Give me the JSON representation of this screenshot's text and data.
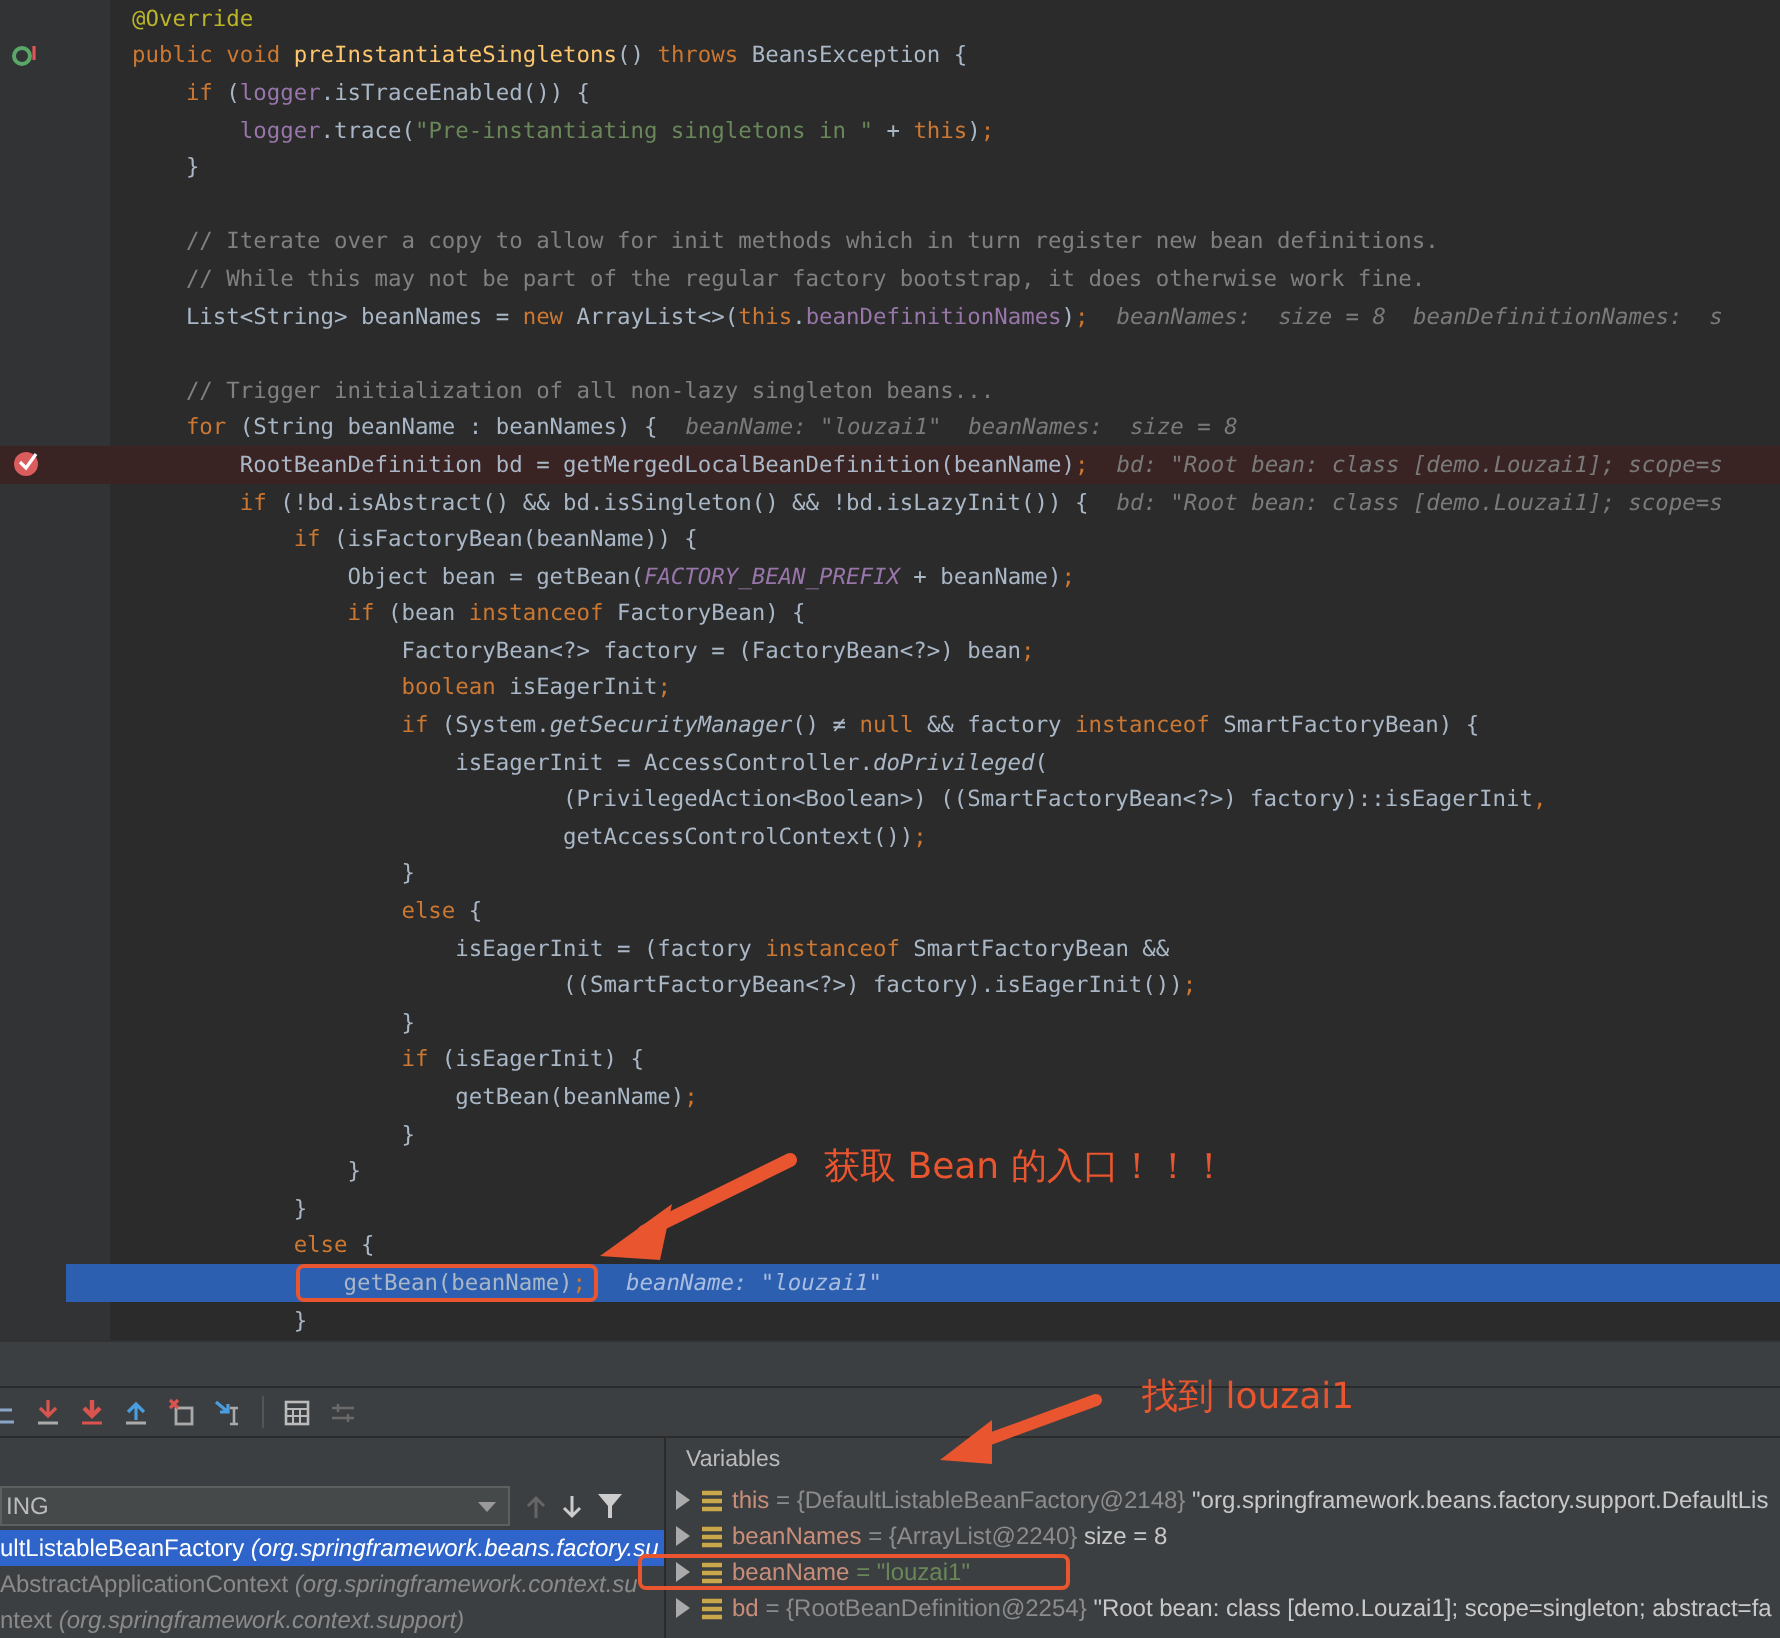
{
  "editor": {
    "lines": [
      {
        "kind": "normal",
        "boxed": false,
        "tokens": [
          {
            "text": "@Override",
            "kind": "annotation"
          }
        ]
      },
      {
        "kind": "declaration",
        "boxed": false,
        "tokens": [
          {
            "text": "public void ",
            "kind": "keyword"
          },
          {
            "text": "preInstantiateSingletons",
            "kind": "declaration"
          },
          {
            "text": "() ",
            "kind": "plain"
          },
          {
            "text": "throws ",
            "kind": "keyword"
          },
          {
            "text": "BeansException {",
            "kind": "plain"
          }
        ]
      },
      {
        "kind": "normal",
        "boxed": false,
        "tokens": [
          {
            "text": "    if ",
            "kind": "keyword"
          },
          {
            "text": "(",
            "kind": "plain"
          },
          {
            "text": "logger",
            "kind": "field"
          },
          {
            "text": ".isTraceEnabled()) {",
            "kind": "plain"
          }
        ]
      },
      {
        "kind": "normal",
        "boxed": false,
        "tokens": [
          {
            "text": "        logger",
            "kind": "field"
          },
          {
            "text": ".trace(",
            "kind": "plain"
          },
          {
            "text": "\"Pre-instantiating singletons in \"",
            "kind": "string"
          },
          {
            "text": " + ",
            "kind": "plain"
          },
          {
            "text": "this",
            "kind": "keyword"
          },
          {
            "text": ")",
            "kind": "plain"
          },
          {
            "text": ";",
            "kind": "keyword"
          }
        ]
      },
      {
        "kind": "normal",
        "boxed": false,
        "tokens": [
          {
            "text": "    }",
            "kind": "plain"
          }
        ]
      },
      {
        "kind": "blank"
      },
      {
        "kind": "normal",
        "boxed": false,
        "tokens": [
          {
            "text": "    // Iterate over a copy to allow for init methods which in turn register new bean definitions.",
            "kind": "comment"
          }
        ]
      },
      {
        "kind": "normal",
        "boxed": false,
        "tokens": [
          {
            "text": "    // While this may not be part of the regular factory bootstrap, it does otherwise work fine.",
            "kind": "comment"
          }
        ]
      },
      {
        "kind": "normal",
        "boxed": false,
        "tokens": [
          {
            "text": "    List<String> beanNames = ",
            "kind": "plain"
          },
          {
            "text": "new ",
            "kind": "keyword"
          },
          {
            "text": "ArrayList<>(",
            "kind": "plain"
          },
          {
            "text": "this",
            "kind": "keyword"
          },
          {
            "text": ".",
            "kind": "plain"
          },
          {
            "text": "beanDefinitionNames",
            "kind": "field"
          },
          {
            "text": ")",
            "kind": "plain"
          },
          {
            "text": ";",
            "kind": "keyword"
          }
        ],
        "hint": "beanNames:  size = 8  beanDefinitionNames:  s"
      },
      {
        "kind": "blank"
      },
      {
        "kind": "normal",
        "boxed": false,
        "tokens": [
          {
            "text": "    // Trigger initialization of all non-lazy singleton beans...",
            "kind": "comment"
          }
        ]
      },
      {
        "kind": "normal",
        "boxed": false,
        "tokens": [
          {
            "text": "    for ",
            "kind": "keyword"
          },
          {
            "text": "(String beanName : beanNames) {",
            "kind": "plain"
          }
        ],
        "hint": "beanName: \"louzai1\"  beanNames:  size = 8"
      },
      {
        "kind": "breakpoint",
        "boxed": false,
        "tokens": [
          {
            "text": "        RootBeanDefinition bd = getMergedLocalBeanDefinition(beanName)",
            "kind": "plain"
          },
          {
            "text": ";",
            "kind": "keyword"
          }
        ],
        "hint": "bd: \"Root bean: class [demo.Louzai1]; scope=s"
      },
      {
        "kind": "normal",
        "boxed": false,
        "tokens": [
          {
            "text": "        if ",
            "kind": "keyword"
          },
          {
            "text": "(!bd.isAbstract() && bd.isSingleton() && !bd.isLazyInit()) {",
            "kind": "plain"
          }
        ],
        "hint": "bd: \"Root bean: class [demo.Louzai1]; scope=s"
      },
      {
        "kind": "normal",
        "boxed": false,
        "tokens": [
          {
            "text": "            if ",
            "kind": "keyword"
          },
          {
            "text": "(isFactoryBean(beanName)) {",
            "kind": "plain"
          }
        ]
      },
      {
        "kind": "normal",
        "boxed": false,
        "tokens": [
          {
            "text": "                Object bean = getBean(",
            "kind": "plain"
          },
          {
            "text": "FACTORY_BEAN_PREFIX",
            "kind": "constant"
          },
          {
            "text": " + beanName)",
            "kind": "plain"
          },
          {
            "text": ";",
            "kind": "keyword"
          }
        ]
      },
      {
        "kind": "normal",
        "boxed": false,
        "tokens": [
          {
            "text": "                if ",
            "kind": "keyword"
          },
          {
            "text": "(bean ",
            "kind": "plain"
          },
          {
            "text": "instanceof ",
            "kind": "keyword"
          },
          {
            "text": "FactoryBean) {",
            "kind": "plain"
          }
        ]
      },
      {
        "kind": "normal",
        "boxed": false,
        "tokens": [
          {
            "text": "                    FactoryBean<?> factory = (FactoryBean<?>) bean",
            "kind": "plain"
          },
          {
            "text": ";",
            "kind": "keyword"
          }
        ]
      },
      {
        "kind": "normal",
        "boxed": false,
        "tokens": [
          {
            "text": "                    boolean ",
            "kind": "keyword"
          },
          {
            "text": "isEagerInit",
            "kind": "plain"
          },
          {
            "text": ";",
            "kind": "keyword"
          }
        ]
      },
      {
        "kind": "normal",
        "boxed": false,
        "tokens": [
          {
            "text": "                    if ",
            "kind": "keyword"
          },
          {
            "text": "(System.",
            "kind": "plain"
          },
          {
            "text": "getSecurityManager",
            "kind": "static"
          },
          {
            "text": "() ≠ ",
            "kind": "plain"
          },
          {
            "text": "null ",
            "kind": "keyword"
          },
          {
            "text": "&& factory ",
            "kind": "plain"
          },
          {
            "text": "instanceof ",
            "kind": "keyword"
          },
          {
            "text": "SmartFactoryBean) {",
            "kind": "plain"
          }
        ]
      },
      {
        "kind": "normal",
        "boxed": false,
        "tokens": [
          {
            "text": "                        isEagerInit = AccessController.",
            "kind": "plain"
          },
          {
            "text": "doPrivileged",
            "kind": "static"
          },
          {
            "text": "(",
            "kind": "plain"
          }
        ]
      },
      {
        "kind": "normal",
        "boxed": false,
        "tokens": [
          {
            "text": "                                (PrivilegedAction<Boolean>) ((SmartFactoryBean<?>) factory)::isEagerInit",
            "kind": "plain"
          },
          {
            "text": ",",
            "kind": "keyword"
          }
        ]
      },
      {
        "kind": "normal",
        "boxed": false,
        "tokens": [
          {
            "text": "                                getAccessControlContext())",
            "kind": "plain"
          },
          {
            "text": ";",
            "kind": "keyword"
          }
        ]
      },
      {
        "kind": "normal",
        "boxed": false,
        "tokens": [
          {
            "text": "                    }",
            "kind": "plain"
          }
        ]
      },
      {
        "kind": "normal",
        "boxed": false,
        "tokens": [
          {
            "text": "                    else ",
            "kind": "keyword"
          },
          {
            "text": "{",
            "kind": "plain"
          }
        ]
      },
      {
        "kind": "normal",
        "boxed": false,
        "tokens": [
          {
            "text": "                        isEagerInit = (factory ",
            "kind": "plain"
          },
          {
            "text": "instanceof ",
            "kind": "keyword"
          },
          {
            "text": "SmartFactoryBean &&",
            "kind": "plain"
          }
        ]
      },
      {
        "kind": "normal",
        "boxed": false,
        "tokens": [
          {
            "text": "                                ((SmartFactoryBean<?>) factory).isEagerInit())",
            "kind": "plain"
          },
          {
            "text": ";",
            "kind": "keyword"
          }
        ]
      },
      {
        "kind": "normal",
        "boxed": false,
        "tokens": [
          {
            "text": "                    }",
            "kind": "plain"
          }
        ]
      },
      {
        "kind": "normal",
        "boxed": false,
        "tokens": [
          {
            "text": "                    if ",
            "kind": "keyword"
          },
          {
            "text": "(isEagerInit) {",
            "kind": "plain"
          }
        ]
      },
      {
        "kind": "normal",
        "boxed": false,
        "tokens": [
          {
            "text": "                        getBean(beanName)",
            "kind": "plain"
          },
          {
            "text": ";",
            "kind": "keyword"
          }
        ]
      },
      {
        "kind": "normal",
        "boxed": false,
        "tokens": [
          {
            "text": "                    }",
            "kind": "plain"
          }
        ]
      },
      {
        "kind": "normal",
        "boxed": false,
        "tokens": [
          {
            "text": "                }",
            "kind": "plain"
          }
        ]
      },
      {
        "kind": "normal",
        "boxed": false,
        "tokens": [
          {
            "text": "            }",
            "kind": "plain"
          }
        ]
      },
      {
        "kind": "normal",
        "boxed": false,
        "tokens": [
          {
            "text": "            else ",
            "kind": "keyword"
          },
          {
            "text": "{",
            "kind": "plain"
          }
        ]
      },
      {
        "kind": "current",
        "boxed": true,
        "tokens": [
          {
            "text": "                getBean(beanName)",
            "kind": "plain"
          },
          {
            "text": ";",
            "kind": "keyword"
          }
        ],
        "hint": "beanName: \"louzai1\""
      },
      {
        "kind": "normal",
        "boxed": false,
        "tokens": [
          {
            "text": "            }",
            "kind": "plain"
          }
        ]
      }
    ]
  },
  "frames": {
    "thread": "ING",
    "items": [
      {
        "method": "ultListableBeanFactory",
        "location": "(org.springframework.beans.factory.su",
        "selected": true
      },
      {
        "method": "AbstractApplicationContext",
        "location": "(org.springframework.context.su",
        "selected": false
      },
      {
        "method": "ntext",
        "location": "(org.springframework.context.support)",
        "selected": false
      }
    ]
  },
  "variables": {
    "title": "Variables",
    "items": [
      {
        "name": "this",
        "value": "= {DefaultListableBeanFactory@2148}",
        "extra": "\"org.springframework.beans.factory.support.DefaultLis",
        "kind": "object",
        "expanded": false,
        "boxed": false
      },
      {
        "name": "beanNames",
        "value": "= {ArrayList@2240}",
        "extra": "size = 8",
        "kind": "object",
        "expanded": false,
        "boxed": false
      },
      {
        "name": "beanName",
        "value": "= \"louzai1\"",
        "kind": "string",
        "expanded": false,
        "boxed": true
      },
      {
        "name": "bd",
        "value": "= {RootBeanDefinition@2254}",
        "extra": "\"Root bean: class [demo.Louzai1]; scope=singleton; abstract=fa",
        "kind": "object",
        "expanded": false,
        "boxed": false
      }
    ]
  },
  "annotations": [
    {
      "kind": "code",
      "text": "获取 Bean 的入口！！！"
    },
    {
      "kind": "variables",
      "text": "找到 louzai1"
    }
  ]
}
